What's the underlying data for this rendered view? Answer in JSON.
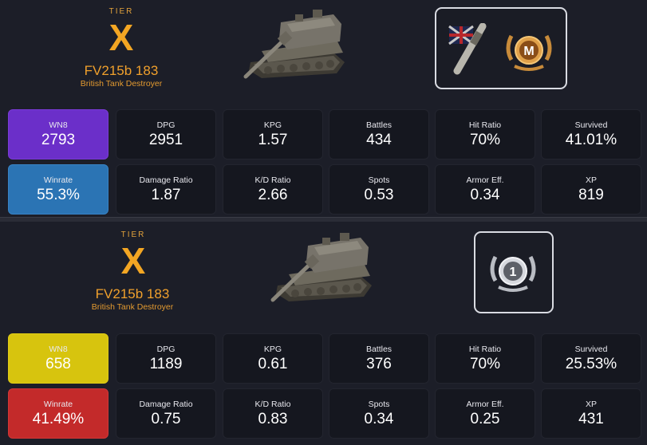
{
  "colors": {
    "tier_accent": "#f3a623",
    "wn8_purple": "#6b2fc9",
    "winrate_blue": "#2b74b4",
    "wn8_yellow": "#d7c40e",
    "winrate_red": "#c32a2a",
    "background": "#1c1e28"
  },
  "cards": [
    {
      "tier_label": "TIER",
      "tier": "X",
      "tank_name": "FV215b 183",
      "tank_class": "British Tank Destroyer",
      "awards": [
        {
          "icon": "uk-flag-shell-icon"
        },
        {
          "icon": "mastery-m-badge-icon",
          "text": "M"
        }
      ],
      "stats_row1": [
        {
          "label": "WN8",
          "value": "2793"
        },
        {
          "label": "DPG",
          "value": "2951"
        },
        {
          "label": "KPG",
          "value": "1.57"
        },
        {
          "label": "Battles",
          "value": "434"
        },
        {
          "label": "Hit Ratio",
          "value": "70%"
        },
        {
          "label": "Survived",
          "value": "41.01%"
        }
      ],
      "stats_row2": [
        {
          "label": "Winrate",
          "value": "55.3%"
        },
        {
          "label": "Damage Ratio",
          "value": "1.87"
        },
        {
          "label": "K/D Ratio",
          "value": "2.66"
        },
        {
          "label": "Spots",
          "value": "0.53"
        },
        {
          "label": "Armor Eff.",
          "value": "0.34"
        },
        {
          "label": "XP",
          "value": "819"
        }
      ]
    },
    {
      "tier_label": "TIER",
      "tier": "X",
      "tank_name": "FV215b 183",
      "tank_class": "British Tank Destroyer",
      "awards": [
        {
          "icon": "mastery-class-1-badge-icon",
          "text": "1"
        }
      ],
      "stats_row1": [
        {
          "label": "WN8",
          "value": "658"
        },
        {
          "label": "DPG",
          "value": "1189"
        },
        {
          "label": "KPG",
          "value": "0.61"
        },
        {
          "label": "Battles",
          "value": "376"
        },
        {
          "label": "Hit Ratio",
          "value": "70%"
        },
        {
          "label": "Survived",
          "value": "25.53%"
        }
      ],
      "stats_row2": [
        {
          "label": "Winrate",
          "value": "41.49%"
        },
        {
          "label": "Damage Ratio",
          "value": "0.75"
        },
        {
          "label": "K/D Ratio",
          "value": "0.83"
        },
        {
          "label": "Spots",
          "value": "0.34"
        },
        {
          "label": "Armor Eff.",
          "value": "0.25"
        },
        {
          "label": "XP",
          "value": "431"
        }
      ]
    }
  ]
}
